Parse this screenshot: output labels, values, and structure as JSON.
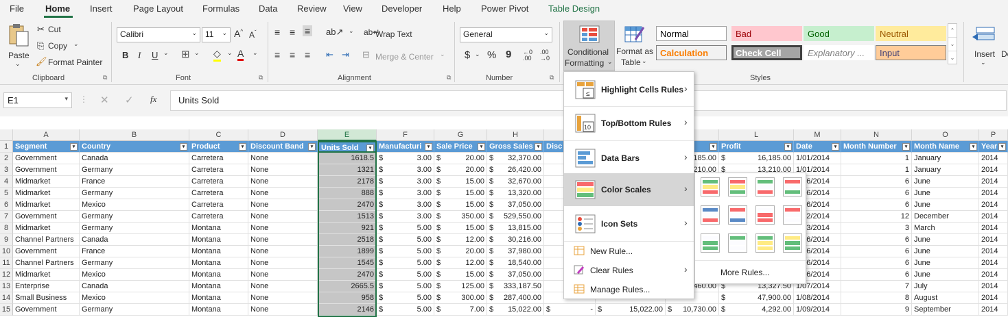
{
  "menu_tabs": [
    "File",
    "Home",
    "Insert",
    "Page Layout",
    "Formulas",
    "Data",
    "Review",
    "View",
    "Developer",
    "Help",
    "Power Pivot",
    "Table Design"
  ],
  "clipboard": {
    "paste": "Paste",
    "cut": "Cut",
    "copy": "Copy",
    "format_painter": "Format Painter",
    "label": "Clipboard"
  },
  "font": {
    "name": "Calibri",
    "size": "11",
    "label": "Font",
    "bold": "B",
    "italic": "I",
    "underline": "U"
  },
  "alignment": {
    "wrap": "Wrap Text",
    "merge": "Merge & Center",
    "label": "Alignment"
  },
  "number": {
    "format": "General",
    "currency": "$",
    "percent": "%",
    "comma": "9",
    "label": "Number"
  },
  "cf_button": {
    "line1": "Conditional",
    "line2": "Formatting"
  },
  "fat_button": {
    "line1": "Format as",
    "line2": "Table"
  },
  "styles": {
    "label": "Styles",
    "cells": [
      {
        "text": "Normal",
        "bg": "#ffffff",
        "fg": "#000000",
        "border": "#a0a0a0"
      },
      {
        "text": "Bad",
        "bg": "#ffc7ce",
        "fg": "#9c0006",
        "border": "#ffc7ce"
      },
      {
        "text": "Good",
        "bg": "#c6efce",
        "fg": "#006100",
        "border": "#c6efce"
      },
      {
        "text": "Neutral",
        "bg": "#ffeb9c",
        "fg": "#9c5700",
        "border": "#ffeb9c"
      },
      {
        "text": "Calculation",
        "bg": "#f2f2f2",
        "fg": "#fa7d00",
        "border": "#7f7f7f"
      },
      {
        "text": "Check Cell",
        "bg": "#a5a5a5",
        "fg": "#ffffff",
        "border": "#3f3f3f"
      },
      {
        "text": "Explanatory ...",
        "bg": "#ffffff",
        "fg": "#7f7f7f",
        "border": "#ffffff"
      },
      {
        "text": "Input",
        "bg": "#ffcc99",
        "fg": "#3f3f76",
        "border": "#7f7f7f"
      }
    ]
  },
  "cells_group": {
    "insert": "Insert",
    "delete": "De"
  },
  "formula_bar": {
    "namebox": "E1",
    "formula": "Units Sold",
    "fx": "fx"
  },
  "columns": [
    "A",
    "B",
    "C",
    "D",
    "E",
    "F",
    "G",
    "H",
    "I",
    "J",
    "K",
    "L",
    "M",
    "N",
    "O",
    "P"
  ],
  "headers": [
    "Segment",
    "Country",
    "Product",
    "Discount Band",
    "Units Sold",
    "Manufacturi",
    "Sale Price",
    "Gross Sales",
    "Disc",
    "",
    "",
    "Profit",
    "Date",
    "Month Number",
    "Month Name",
    "Year"
  ],
  "rows": [
    [
      "Government",
      "Canada",
      "Carretera",
      "None",
      "1618.5",
      "3.00",
      "20.00",
      "32,370.00",
      "",
      "",
      "185.00",
      "16,185.00",
      "1/01/2014",
      "1",
      "January",
      "2014"
    ],
    [
      "Government",
      "Germany",
      "Carretera",
      "None",
      "1321",
      "3.00",
      "20.00",
      "26,420.00",
      "",
      "",
      "210.00",
      "13,210.00",
      "1/01/2014",
      "1",
      "January",
      "2014"
    ],
    [
      "Midmarket",
      "France",
      "Carretera",
      "None",
      "2178",
      "3.00",
      "15.00",
      "32,670.00",
      "",
      "",
      "",
      "",
      "1/06/2014",
      "6",
      "June",
      "2014"
    ],
    [
      "Midmarket",
      "Germany",
      "Carretera",
      "None",
      "888",
      "3.00",
      "15.00",
      "13,320.00",
      "",
      "",
      "",
      "",
      "1/06/2014",
      "6",
      "June",
      "2014"
    ],
    [
      "Midmarket",
      "Mexico",
      "Carretera",
      "None",
      "2470",
      "3.00",
      "15.00",
      "37,050.00",
      "",
      "",
      "",
      "",
      "1/06/2014",
      "6",
      "June",
      "2014"
    ],
    [
      "Government",
      "Germany",
      "Carretera",
      "None",
      "1513",
      "3.00",
      "350.00",
      "529,550.00",
      "",
      "",
      "",
      "",
      "1/12/2014",
      "12",
      "December",
      "2014"
    ],
    [
      "Midmarket",
      "Germany",
      "Montana",
      "None",
      "921",
      "5.00",
      "15.00",
      "13,815.00",
      "",
      "",
      "",
      "",
      "1/03/2014",
      "3",
      "March",
      "2014"
    ],
    [
      "Channel Partners",
      "Canada",
      "Montana",
      "None",
      "2518",
      "5.00",
      "12.00",
      "30,216.00",
      "",
      "",
      "",
      "",
      "1/06/2014",
      "6",
      "June",
      "2014"
    ],
    [
      "Government",
      "France",
      "Montana",
      "None",
      "1899",
      "5.00",
      "20.00",
      "37,980.00",
      "",
      "",
      "",
      "",
      "1/06/2014",
      "6",
      "June",
      "2014"
    ],
    [
      "Channel Partners",
      "Germany",
      "Montana",
      "None",
      "1545",
      "5.00",
      "12.00",
      "18,540.00",
      "",
      "",
      "",
      "",
      "1/06/2014",
      "6",
      "June",
      "2014"
    ],
    [
      "Midmarket",
      "Mexico",
      "Montana",
      "None",
      "2470",
      "5.00",
      "15.00",
      "37,050.00",
      "",
      "",
      "",
      "",
      "1/06/2014",
      "6",
      "June",
      "2014"
    ],
    [
      "Enterprise",
      "Canada",
      "Montana",
      "None",
      "2665.5",
      "5.00",
      "125.00",
      "333,187.50",
      "",
      "",
      "460.00",
      "13,327.50",
      "1/07/2014",
      "7",
      "July",
      "2014"
    ],
    [
      "Small Business",
      "Mexico",
      "Montana",
      "None",
      "958",
      "5.00",
      "300.00",
      "287,400.00",
      "",
      "",
      "",
      "47,900.00",
      "1/08/2014",
      "8",
      "August",
      "2014"
    ],
    [
      "Government",
      "Germany",
      "Montana",
      "None",
      "2146",
      "5.00",
      "7.00",
      "15,022.00",
      "-",
      "15,022.00",
      "10,730.00",
      "4,292.00",
      "1/09/2014",
      "9",
      "September",
      "2014"
    ]
  ],
  "cf_menu": {
    "items": [
      {
        "label": "Highlight Cells Rules",
        "icon": "highlight-cells-icon"
      },
      {
        "label": "Top/Bottom Rules",
        "icon": "top-bottom-icon"
      },
      {
        "label": "Data Bars",
        "icon": "data-bars-icon"
      },
      {
        "label": "Color Scales",
        "icon": "color-scales-icon"
      },
      {
        "label": "Icon Sets",
        "icon": "icon-sets-icon"
      }
    ],
    "new_rule": "New Rule...",
    "clear_rules": "Clear Rules",
    "manage_rules": "Manage Rules..."
  },
  "color_scales": {
    "more_rules": "More Rules...",
    "swatches": [
      [
        "#63be7b",
        "#ffeb84",
        "#f8696b"
      ],
      [
        "#f8696b",
        "#ffeb84",
        "#63be7b"
      ],
      [
        "#63be7b",
        "#fcfcff",
        "#f8696b"
      ],
      [
        "#f8696b",
        "#fcfcff",
        "#63be7b"
      ],
      [
        "#5a8ac6",
        "#fcfcff",
        "#f8696b"
      ],
      [
        "#f8696b",
        "#fcfcff",
        "#5a8ac6"
      ],
      [
        "#fcfcff",
        "#f8696b",
        "#f8696b"
      ],
      [
        "#f8696b",
        "#fcfcff",
        "#fcfcff"
      ],
      [
        "#fcfcff",
        "#63be7b",
        "#63be7b"
      ],
      [
        "#63be7b",
        "#fcfcff",
        "#fcfcff"
      ],
      [
        "#63be7b",
        "#ffeb84",
        "#ffeb84"
      ],
      [
        "#ffeb84",
        "#63be7b",
        "#63be7b"
      ]
    ]
  }
}
